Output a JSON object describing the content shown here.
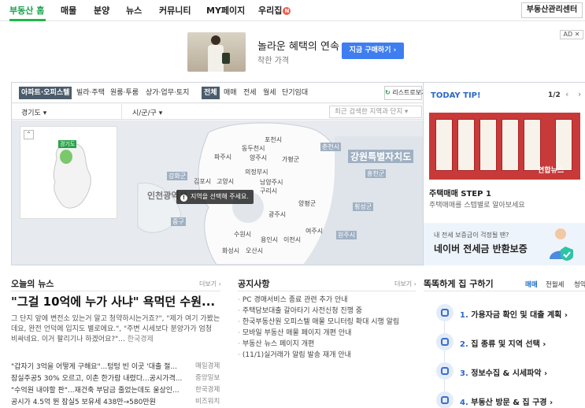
{
  "gnb": {
    "items": [
      "부동산 홈",
      "매물",
      "분양",
      "뉴스",
      "커뮤니티",
      "MY페이지",
      "우리집"
    ],
    "badge": "N",
    "center_button": "부동산관리센터"
  },
  "ad": {
    "mark": "AD ✕",
    "headline": "놀라운 혜택의 연속",
    "sub": "착한 가격",
    "button": "지금 구매하기 ›"
  },
  "map": {
    "type_tabs": [
      "아파트·오피스텔",
      "빌라·주택",
      "원룸·투룸",
      "상가·업무·토지"
    ],
    "deal_tabs": [
      "전체",
      "매매",
      "전세",
      "월세",
      "단기임대"
    ],
    "list_view": "리스트로보기",
    "province": "경기도",
    "city": "시/군/구",
    "recent_placeholder": "최근 검색한 지역과 단지",
    "minimap_zoom": "⌃",
    "minimap_label": "경기도",
    "tooltip": "지역을 선택해 주세요.",
    "labels": {
      "pocheon": "포천시",
      "dongducheon": "동두천시",
      "paju": "파주시",
      "yangju": "양주시",
      "gapyeong": "가평군",
      "chuncheon": "춘천시",
      "gangwon": "강원특별자치도",
      "uijeongbu": "의정부시",
      "gimpo": "김포시",
      "goyang": "고양시",
      "namyangju": "남양주시",
      "hongcheon": "홍천군",
      "ganghwa": "강화군",
      "guri": "구리시",
      "incheon": "인천광역시",
      "yangpyeong": "양평군",
      "hoengseong": "횡성군",
      "gwangju": "광주시",
      "junggu": "중구",
      "wonju": "원주시",
      "yeoju": "여주시",
      "suwon": "수원시",
      "yongin": "용인시",
      "icheon": "이천시",
      "hwaseong": "화성시",
      "osan": "오산시"
    }
  },
  "tip": {
    "title": "TODAY TIP!",
    "page": "1/2",
    "arrows": "‹ ›",
    "image_caption": "연합뉴스",
    "card_title": "주택매매 STEP 1",
    "card_desc": "주택매매를 스텝별로 알아보세요",
    "banner_small": "내 전세 보증금이 걱정될 땐?",
    "banner_big": "네이버 전세금 반환보증"
  },
  "news": {
    "title": "오늘의 뉴스",
    "more": "더보기 ›",
    "headline": "\"그걸 10억에 누가 사냐\" 욕먹던 수원...",
    "summary": "그 단지 앞에 변전소 있는거 알고 청약하시는거죠?\", \"제가 여기 가봤는데요, 완전 언덕에 입지도 별로에요.\", \"주변 시세보다 분양가가 엄청 비싸네요. 이거 팔리기나 하겠어요?\"...",
    "summary_src": "한국경제",
    "items": [
      {
        "title": "\"갑자기 3억을 어떻게 구해요\"...텅텅 빈 이곳 '대출 절...",
        "src": "매일경제"
      },
      {
        "title": "잠실주공5 30% 오르고, 이촌 한가람 내렸다...공시가격...",
        "src": "중앙일보"
      },
      {
        "title": "\"수억원 내야할 판\"...재건축 부담금 줄었는데도 울상인...",
        "src": "한국경제"
      },
      {
        "title": "공시가 4.5억 뛴 잠실5 보유세 438만→580만원",
        "src": "비즈워치"
      }
    ]
  },
  "notice": {
    "title": "공지사항",
    "more": "더보기 ›",
    "items": [
      "PC 경매서비스 종료 관련 추가 안내",
      "주택담보대출 갈아타기 사전신청 진행 중",
      "한국부동산원 오피스텔 매물 모니터링 확대 시행 알림",
      "모바일 부동산 매물 페이지 개편 안내",
      "부동산 뉴스 페이지 개편",
      "(11/1)실거래가 알림 발송 재개 안내"
    ]
  },
  "house": {
    "title": "똑똑하게 집 구하기",
    "tabs": [
      "매매",
      "전월세",
      "청약"
    ],
    "steps": [
      {
        "num": "1.",
        "label": "가용자금 확인 및 대출 계획 ›"
      },
      {
        "num": "2.",
        "label": "집 종류 및 지역 선택 ›"
      },
      {
        "num": "3.",
        "label": "정보수집 & 시세파악 ›"
      },
      {
        "num": "4.",
        "label": "부동산 방문 & 집 구경 ›"
      }
    ]
  },
  "colors": {
    "brand_green": "#1fb84a",
    "accent_blue": "#2b68c9",
    "button_blue": "#3e7ef0"
  }
}
